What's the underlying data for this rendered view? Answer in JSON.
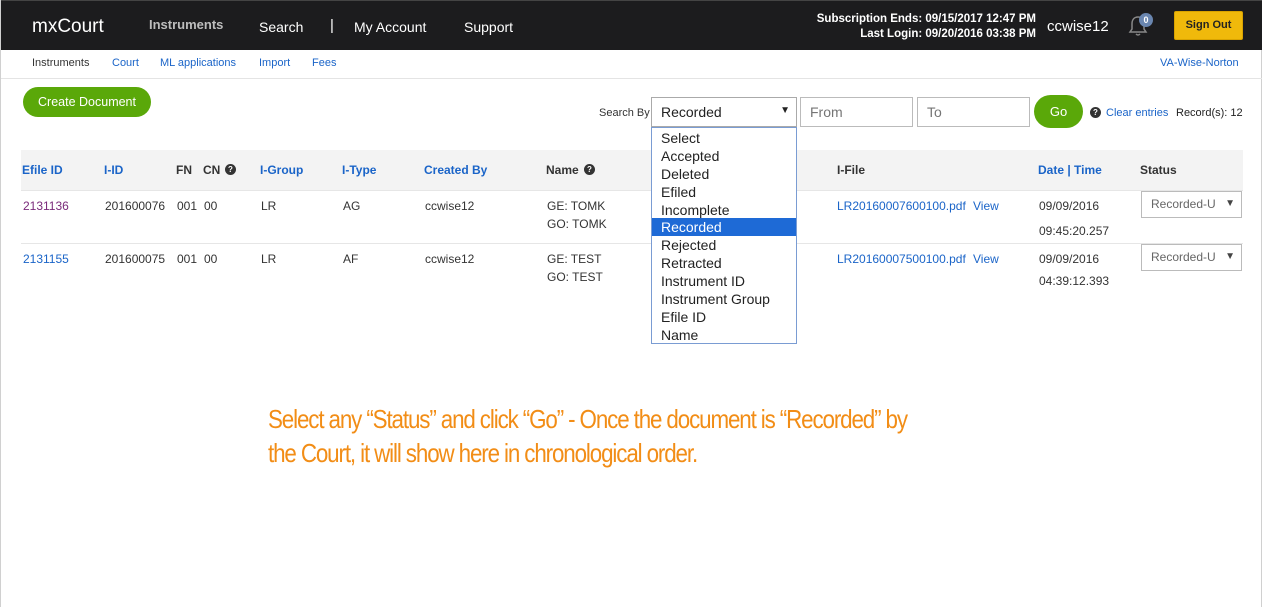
{
  "header": {
    "brand": "mxCourt",
    "nav": [
      "Instruments",
      "Search",
      "|",
      "My Account",
      "Support"
    ],
    "subscription": "Subscription Ends: 09/15/2017 12:47 PM",
    "last_login": "Last Login: 09/20/2016 03:38 PM",
    "username": "ccwise12",
    "notifications": "0",
    "signout_label": "Sign Out"
  },
  "subnav": {
    "items": [
      "Instruments",
      "Court",
      "ML applications",
      "Import",
      "Fees"
    ],
    "location": "VA-Wise-Norton"
  },
  "toolbar": {
    "create_label": "Create Document",
    "search_by_label": "Search By",
    "search_by_value": "Recorded",
    "from_placeholder": "From",
    "to_placeholder": "To",
    "go_label": "Go",
    "clear_label": "Clear entries",
    "records_label": "Record(s): 12"
  },
  "dropdown": {
    "options": [
      "Select",
      "Accepted",
      "Deleted",
      "Efiled",
      "Incomplete",
      "Recorded",
      "Rejected",
      "Retracted",
      "Instrument ID",
      "Instrument Group",
      "Efile ID",
      "Name"
    ],
    "selected": "Recorded"
  },
  "table": {
    "headers": [
      "Efile ID",
      "I-ID",
      "FN",
      "CN",
      "I-Group",
      "I-Type",
      "Created By",
      "Name",
      "I-File",
      "Date | Time",
      "Status"
    ],
    "rows": [
      {
        "efile_id": "2131136",
        "i_id": "201600076",
        "fn": "001",
        "cn": "00",
        "i_group": "LR",
        "i_type": "AG",
        "created_by": "ccwise12",
        "name1": "GE: TOMK",
        "name2": "GO: TOMK",
        "i_file": "LR20160007600100.pdf",
        "view": "View",
        "date": "09/09/2016",
        "time": "09:45:20.257",
        "status": "Recorded-U"
      },
      {
        "efile_id": "2131155",
        "i_id": "201600075",
        "fn": "001",
        "cn": "00",
        "i_group": "LR",
        "i_type": "AF",
        "created_by": "ccwise12",
        "name1": "GE: TEST",
        "name2": "GO: TEST",
        "i_file": "LR20160007500100.pdf",
        "view": "View",
        "date": "09/09/2016",
        "time": "04:39:12.393",
        "status": "Recorded-U"
      }
    ]
  },
  "annotation": {
    "text": "Select any “Status” and click “Go” - Once the document is “Recorded” by the Court, it will show here in chronological order."
  },
  "colors": {
    "brand_bar": "#1c1c1e",
    "accent_green": "#5aa809",
    "signout": "#f0b90b",
    "link": "#1a64c8",
    "annotation": "#f28d16"
  }
}
